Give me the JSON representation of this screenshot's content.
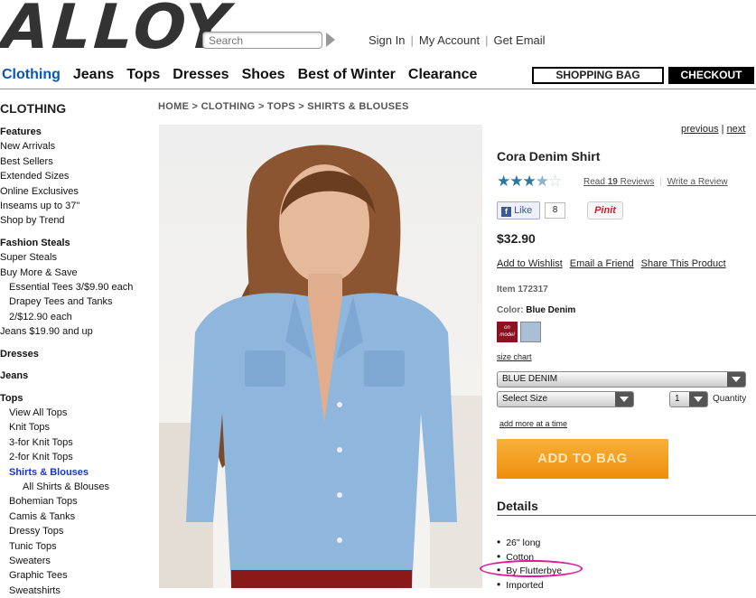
{
  "header": {
    "logo_text": "ALLOY",
    "search_placeholder": "Search",
    "links": [
      "Sign In",
      "My Account",
      "Get Email"
    ]
  },
  "nav": {
    "items": [
      "Clothing",
      "Jeans",
      "Tops",
      "Dresses",
      "Shoes",
      "Best of Winter",
      "Clearance"
    ],
    "shopping_bag": "SHOPPING BAG",
    "checkout": "CHECKOUT"
  },
  "sidebar": {
    "title": "CLOTHING",
    "items": [
      {
        "label": "Features",
        "type": "h"
      },
      {
        "label": "New Arrivals",
        "type": ""
      },
      {
        "label": "Best Sellers",
        "type": ""
      },
      {
        "label": "Extended Sizes",
        "type": ""
      },
      {
        "label": "Online Exclusives",
        "type": ""
      },
      {
        "label": "Inseams up to 37\"",
        "type": ""
      },
      {
        "label": "Shop by Trend",
        "type": ""
      },
      {
        "label": "",
        "type": "gap"
      },
      {
        "label": "Fashion Steals",
        "type": "h"
      },
      {
        "label": "Super Steals",
        "type": ""
      },
      {
        "label": "Buy More & Save",
        "type": ""
      },
      {
        "label": "Essential Tees 3/$9.90 each",
        "type": "ind"
      },
      {
        "label": "Drapey Tees and Tanks",
        "type": "ind"
      },
      {
        "label": "2/$12.90 each",
        "type": "ind"
      },
      {
        "label": "Jeans $19.90 and up",
        "type": ""
      },
      {
        "label": "",
        "type": "gap"
      },
      {
        "label": "Dresses",
        "type": "h"
      },
      {
        "label": "",
        "type": "gap"
      },
      {
        "label": "Jeans",
        "type": "h"
      },
      {
        "label": "",
        "type": "gap"
      },
      {
        "label": "Tops",
        "type": "h"
      },
      {
        "label": "View All Tops",
        "type": "ind"
      },
      {
        "label": "Knit Tops",
        "type": "ind"
      },
      {
        "label": "3-for Knit Tops",
        "type": "ind"
      },
      {
        "label": "2-for Knit Tops",
        "type": "ind"
      },
      {
        "label": "Shirts & Blouses",
        "type": "ind sel"
      },
      {
        "label": "All Shirts & Blouses",
        "type": "ind2"
      },
      {
        "label": "Bohemian Tops",
        "type": "ind"
      },
      {
        "label": "Camis & Tanks",
        "type": "ind"
      },
      {
        "label": "Dressy Tops",
        "type": "ind"
      },
      {
        "label": "Tunic Tops",
        "type": "ind"
      },
      {
        "label": "Sweaters",
        "type": "ind"
      },
      {
        "label": "Graphic Tees",
        "type": "ind"
      },
      {
        "label": "Sweatshirts",
        "type": "ind"
      }
    ]
  },
  "breadcrumb": "HOME > CLOTHING > TOPS > SHIRTS & BLOUSES",
  "pager": {
    "previous": "previous",
    "sep": "|",
    "next": "next"
  },
  "product": {
    "name": "Cora Denim Shirt",
    "rating": 3.5,
    "rating_max": 5,
    "reviews_prefix": "Read ",
    "reviews_count": "19",
    "reviews_suffix": " Reviews",
    "write_review": "Write a Review",
    "like_label": "Like",
    "like_count": "8",
    "pinit": "Pinit",
    "price": "$32.90",
    "actions": [
      "Add to Wishlist",
      "Email a Friend",
      "Share This Product"
    ],
    "item_number": "Item 172317",
    "color_label": "Color:",
    "color_value": "Blue Denim",
    "swatch_on_model": "on model",
    "size_chart": "size chart",
    "color_select": "BLUE DENIM",
    "size_select": "Select Size",
    "qty_select": "1",
    "qty_label": "Quantity",
    "add_more": "add more at a time",
    "add_to_bag": "ADD TO BAG",
    "details_title": "Details",
    "details": [
      "26\" long",
      "Cotton",
      "By Flutterbye",
      "Imported"
    ]
  },
  "colors": {
    "nav_active": "#0a56b4",
    "add_to_bag": "#f0940e",
    "star": "#2a78a4",
    "annotation_circle": "#e0179a"
  }
}
